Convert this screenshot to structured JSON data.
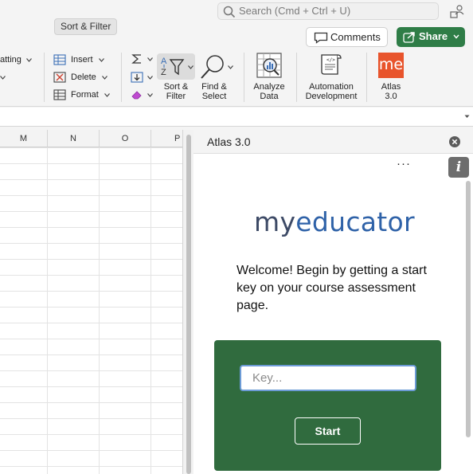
{
  "tooltip": "Sort & Filter",
  "search": {
    "placeholder": "Search (Cmd + Ctrl + U)"
  },
  "header": {
    "comments_label": "Comments",
    "share_label": "Share"
  },
  "ribbon": {
    "cut_label": "atting",
    "insert_label": "Insert",
    "delete_label": "Delete",
    "format_label": "Format",
    "sort_filter": [
      "Sort &",
      "Filter"
    ],
    "find_select": [
      "Find &",
      "Select"
    ],
    "analyze_data": [
      "Analyze",
      "Data"
    ],
    "automation": [
      "Automation",
      "Development"
    ],
    "atlas": [
      "Atlas",
      "3.0"
    ],
    "atlas_logo_text": "me",
    "atlas_color": "#e8542c"
  },
  "sheet": {
    "columns": [
      "M",
      "N",
      "O",
      "P"
    ]
  },
  "pane": {
    "title": "Atlas 3.0",
    "info_label": "i",
    "more_label": "···",
    "logo": {
      "my": "my",
      "educator": "educator"
    },
    "welcome": "Welcome! Begin by getting a start key on your course assessment page.",
    "key_placeholder": "Key...",
    "start_label": "Start",
    "card_color": "#306b3e"
  }
}
